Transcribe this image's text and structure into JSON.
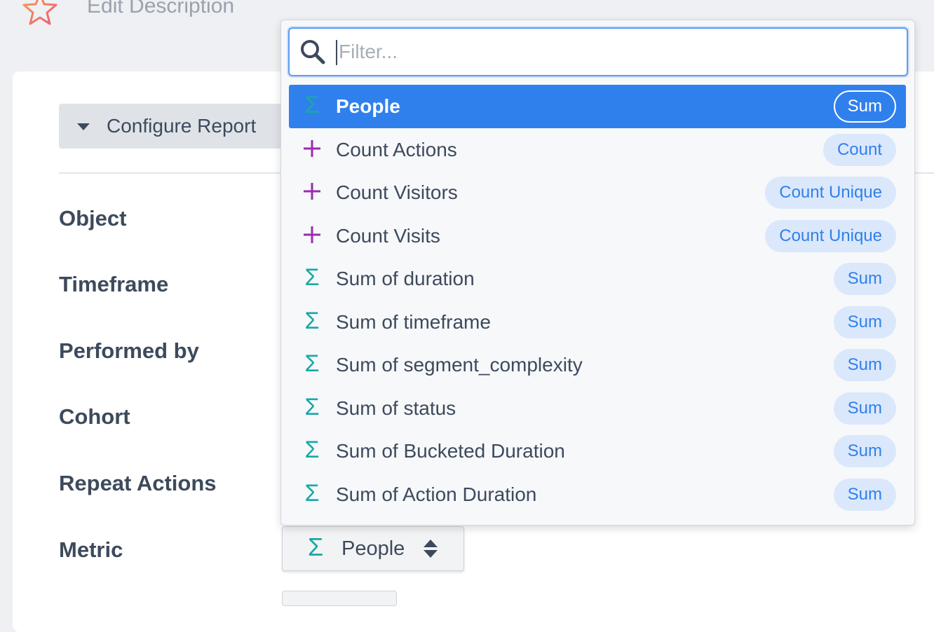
{
  "header": {
    "edit_description": "Edit Description"
  },
  "configure": {
    "label": "Configure Report"
  },
  "fields": {
    "object": "Object",
    "timeframe": "Timeframe",
    "performed_by": "Performed by",
    "cohort": "Cohort",
    "repeat_actions": "Repeat Actions",
    "metric": "Metric"
  },
  "metric_select": {
    "value": "People",
    "icon": "sigma-icon"
  },
  "dropdown": {
    "filter_placeholder": "Filter...",
    "options": [
      {
        "label": "People",
        "badge": "Sum",
        "icon": "sigma",
        "selected": true
      },
      {
        "label": "Count Actions",
        "badge": "Count",
        "icon": "plus"
      },
      {
        "label": "Count Visitors",
        "badge": "Count Unique",
        "icon": "plus"
      },
      {
        "label": "Count Visits",
        "badge": "Count Unique",
        "icon": "plus"
      },
      {
        "label": "Sum of duration",
        "badge": "Sum",
        "icon": "sigma"
      },
      {
        "label": "Sum of timeframe",
        "badge": "Sum",
        "icon": "sigma"
      },
      {
        "label": "Sum of segment_complexity",
        "badge": "Sum",
        "icon": "sigma"
      },
      {
        "label": "Sum of status",
        "badge": "Sum",
        "icon": "sigma"
      },
      {
        "label": "Sum of Bucketed Duration",
        "badge": "Sum",
        "icon": "sigma"
      },
      {
        "label": "Sum of Action Duration",
        "badge": "Sum",
        "icon": "sigma"
      }
    ]
  },
  "colors": {
    "accent": "#2f80ed",
    "sigma": "#18a9a5",
    "plus": "#9b2bb0",
    "badge_bg": "#dbe8fb"
  }
}
